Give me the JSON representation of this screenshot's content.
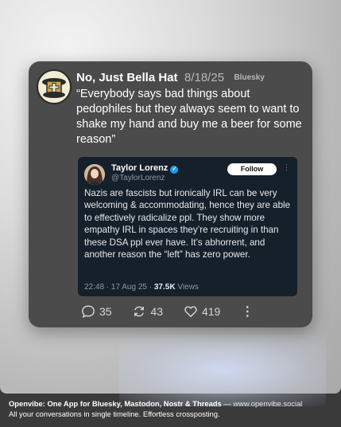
{
  "post": {
    "author": "No, Just Bella Hat",
    "date": "8/18/25",
    "source": "Bluesky",
    "text": "“Everybody says bad things about pedophiles but they always seem to want to shake my hand and buy me a beer for some reason”",
    "stats": {
      "replies": "35",
      "reposts": "43",
      "likes": "419"
    }
  },
  "quote": {
    "name": "Taylor Lorenz",
    "handle": "@TaylorLorenz",
    "follow_label": "Follow",
    "body": "Nazis are fascists but ironically IRL can be very welcoming & accommodating, hence they are able to effectively radicalize ppl. They show more empathy IRL in spaces they’re recruiting in than these DSA ppl ever have. It’s abhorrent, and another reason the “left” has zero power.",
    "time": "22:48 · 17 Aug 25 ·",
    "views_count": "37.5K",
    "views_label": "Views"
  },
  "footer": {
    "brand": "Openvibe: One App for Bluesky, Mastodon, Nostr & Threads",
    "dash": " — ",
    "url": "www.openvibe.social",
    "tagline": "All your conversations in single timeline. Effortless crossposting."
  },
  "colors": {
    "card": "#4b4b4c",
    "quote_bg": "#15202b",
    "verified": "#1d9bf0"
  },
  "icons": [
    "reply-icon",
    "repost-icon",
    "like-icon",
    "more-icon",
    "verified-icon"
  ]
}
